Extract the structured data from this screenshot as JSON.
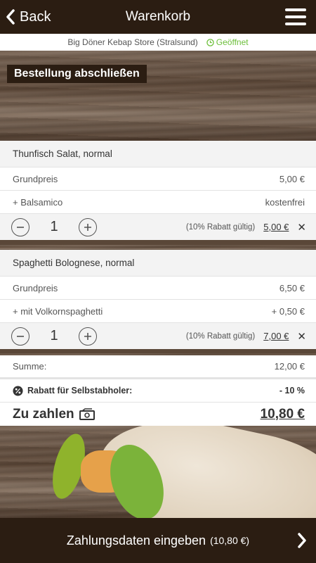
{
  "header": {
    "back_label": "Back",
    "title": "Warenkorb"
  },
  "store": {
    "name": "Big Döner Kebap Store (Stralsund)",
    "status": "Geöffnet",
    "status_color": "#6cbf3a"
  },
  "hero_title": "Bestellung abschließen",
  "items": [
    {
      "name": "Thunfisch Salat, normal",
      "base_label": "Grundpreis",
      "base_price": "5,00 €",
      "extra_label": "+ Balsamico",
      "extra_price": "kostenfrei",
      "quantity": "1",
      "discount_note": "(10% Rabatt gültig)",
      "total": "5,00 €"
    },
    {
      "name": "Spaghetti Bolognese, normal",
      "base_label": "Grundpreis",
      "base_price": "6,50 €",
      "extra_label": "+ mit Volkornspaghetti",
      "extra_price": "+ 0,50 €",
      "quantity": "1",
      "discount_note": "(10% Rabatt gültig)",
      "total": "7,00 €"
    }
  ],
  "summary": {
    "sum_label": "Summe:",
    "sum_value": "12,00 €",
    "discount_label": "Rabatt für Selbstabholer:",
    "discount_value": "- 10 %",
    "total_label": "Zu zahlen",
    "total_value": "10,80 €"
  },
  "footer": {
    "label": "Zahlungsdaten eingeben",
    "amount": "(10,80 €)"
  },
  "colors": {
    "dark_brown": "#2b1d12",
    "accent_green": "#6cbf3a"
  }
}
